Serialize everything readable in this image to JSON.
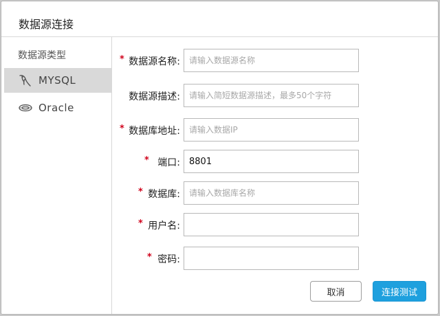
{
  "dialog": {
    "title": "数据源连接"
  },
  "sidebar": {
    "heading": "数据源类型",
    "items": [
      {
        "label": "MYSQL",
        "icon": "mysql-dolphin-icon",
        "selected": true
      },
      {
        "label": "Oracle",
        "icon": "oracle-db-icon",
        "selected": false
      }
    ]
  },
  "form": {
    "fields": [
      {
        "label": "数据源名称:",
        "required": true,
        "value": "",
        "placeholder": "请输入数据源名称"
      },
      {
        "label": "数据源描述:",
        "required": false,
        "value": "",
        "placeholder": "请输入简短数据源描述，最多50个字符"
      },
      {
        "label": "数据库地址:",
        "required": true,
        "value": "",
        "placeholder": "请输入数据IP"
      },
      {
        "label": "端口:",
        "required": true,
        "value": "8801",
        "placeholder": ""
      },
      {
        "label": "数据库:",
        "required": true,
        "value": "",
        "placeholder": "请输入数据库名称"
      },
      {
        "label": "用户名:",
        "required": true,
        "value": "",
        "placeholder": ""
      },
      {
        "label": "密码:",
        "required": true,
        "value": "",
        "placeholder": ""
      }
    ]
  },
  "buttons": {
    "cancel_label": "取消",
    "test_label": "连接测试"
  },
  "colors": {
    "accent": "#1ea0de",
    "required": "#d0021b",
    "selected_bg": "#d9d9d9"
  }
}
